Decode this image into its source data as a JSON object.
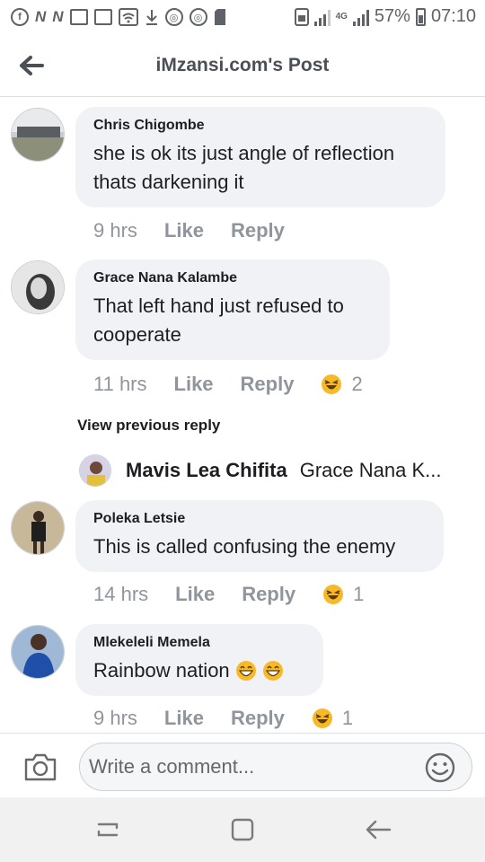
{
  "status_bar": {
    "left_icons": [
      "facebook-icon",
      "news-icon",
      "news-icon",
      "gallery-icon",
      "gallery-icon",
      "wifi-icon",
      "download-icon",
      "sync-icon",
      "sync-icon",
      "sd-card-icon"
    ],
    "network": "4G",
    "battery": "57%",
    "battery_level": 0.57,
    "time": "07:10"
  },
  "header": {
    "title": "iMzansi.com's Post",
    "back_icon": "arrow-left-icon"
  },
  "comments": [
    {
      "name": "Chris Chigombe",
      "lines": [
        "she is ok its just angle of reflection",
        "thats darkening it"
      ],
      "time": "9 hrs",
      "like": "Like",
      "reply": "Reply",
      "reaction_count": ""
    },
    {
      "name": "Grace Nana Kalambe",
      "lines": [
        "That left hand just refused to",
        "cooperate"
      ],
      "time": "11 hrs",
      "like": "Like",
      "reply": "Reply",
      "reaction_count": "2"
    },
    {
      "name": "Poleka Letsie",
      "lines": [
        "This is called confusing the enemy"
      ],
      "time": "14 hrs",
      "like": "Like",
      "reply": "Reply",
      "reaction_count": "1"
    },
    {
      "name": "Mlekeleli Memela",
      "lines": [
        "Rainbow nation"
      ],
      "time": "9 hrs",
      "like": "Like",
      "reply": "Reply",
      "reaction_count": "1"
    }
  ],
  "view_previous": "View previous reply",
  "reply_preview": {
    "name": "Mavis Lea Chifita",
    "snippet": "Grace Nana K..."
  },
  "composer": {
    "placeholder": "Write a comment...",
    "camera_icon": "camera-icon",
    "sticker_icon": "smiley-icon"
  },
  "navbar": {
    "icons": [
      "recent-apps-icon",
      "home-icon",
      "back-icon"
    ]
  },
  "colors": {
    "bubble": "#f0f2f5",
    "meta_text": "#90949c",
    "emoji": "#f7b928"
  }
}
